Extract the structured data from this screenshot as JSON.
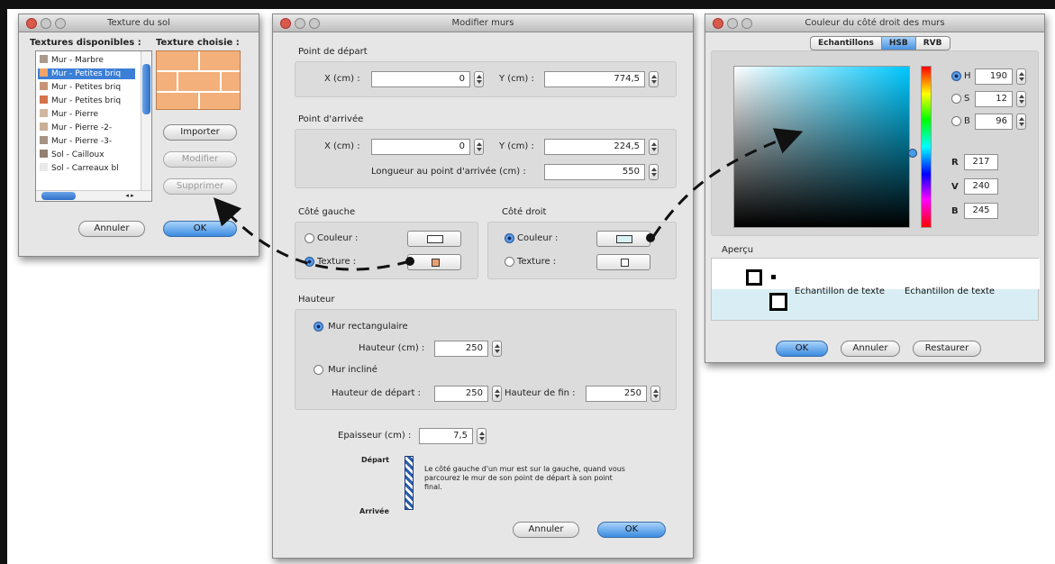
{
  "windows": {
    "texture": {
      "title": "Texture du sol",
      "available_label": "Textures disponibles :",
      "chosen_label": "Texture choisie :",
      "items": [
        {
          "label": "Mur - Marbre",
          "swatch": "#a99a8c",
          "selected": false
        },
        {
          "label": "Mur - Petites briq",
          "swatch": "#f0a468",
          "selected": true
        },
        {
          "label": "Mur - Petites briq",
          "swatch": "#c79475",
          "selected": false
        },
        {
          "label": "Mur - Petites briq",
          "swatch": "#d4744a",
          "selected": false
        },
        {
          "label": "Mur - Pierre",
          "swatch": "#d2b8a0",
          "selected": false
        },
        {
          "label": "Mur - Pierre -2-",
          "swatch": "#c8b098",
          "selected": false
        },
        {
          "label": "Mur - Pierre -3-",
          "swatch": "#a69384",
          "selected": false
        },
        {
          "label": "Sol - Cailloux",
          "swatch": "#928070",
          "selected": false
        },
        {
          "label": "Sol - Carreaux bl",
          "swatch": "#e8e8e8",
          "selected": false
        }
      ],
      "import_button": "Importer",
      "modify_button": "Modifier",
      "delete_button": "Supprimer",
      "cancel_button": "Annuler",
      "ok_button": "OK"
    },
    "walls": {
      "title": "Modifier murs",
      "start_group": "Point de départ",
      "x_label": "X (cm) :",
      "y_label": "Y (cm) :",
      "start_x": "0",
      "start_y": "774,5",
      "end_group": "Point d'arrivée",
      "end_x": "0",
      "end_y": "224,5",
      "length_label": "Longueur au point d'arrivée (cm) :",
      "length": "550",
      "left_side_group": "Côté gauche",
      "right_side_group": "Côté droit",
      "color_label": "Couleur :",
      "texture_label": "Texture :",
      "height_group": "Hauteur",
      "rect_label": "Mur rectangulaire",
      "height_label": "Hauteur (cm) :",
      "height": "250",
      "sloped_label": "Mur incliné",
      "start_height_label": "Hauteur de départ :",
      "start_height": "250",
      "end_height_label": "Hauteur de fin :",
      "end_height": "250",
      "thickness_label": "Epaisseur (cm) :",
      "thickness": "7,5",
      "depart_label": "Départ",
      "arrivee_label": "Arrivée",
      "help_text": "Le côté gauche d'un mur est sur la gauche, quand vous parcourez le mur de son point de départ à son point final.",
      "cancel_button": "Annuler",
      "ok_button": "OK"
    },
    "color": {
      "title": "Couleur du côté droit des murs",
      "tabs": [
        "Echantillons",
        "HSB",
        "RVB"
      ],
      "active_tab": "HSB",
      "h_label": "H",
      "h_value": "190",
      "s_label": "S",
      "s_value": "12",
      "b_label": "B",
      "b_value": "96",
      "r_label": "R",
      "r_value": "217",
      "v_label": "V",
      "v_value": "240",
      "b2_label": "B",
      "b2_value": "245",
      "preview_label": "Aperçu",
      "sample_text_1": "Echantillon de texte",
      "sample_text_2": "Echantillon de texte",
      "ok_button": "OK",
      "cancel_button": "Annuler",
      "restore_button": "Restaurer"
    }
  },
  "colors": {
    "brick": "#f3b07a",
    "selection": "#3b7fd6",
    "arrow": "#111111"
  }
}
